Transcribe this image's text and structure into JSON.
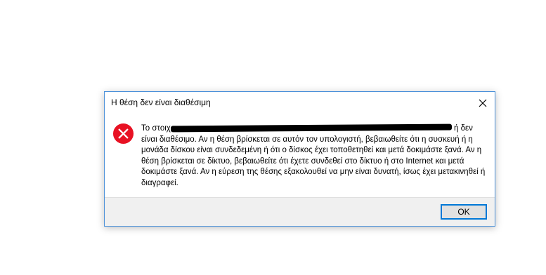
{
  "dialog": {
    "title": "Η θέση δεν είναι διαθέσιμη",
    "message_start": "Το στοιχ",
    "message_after_redaction": "ή δεν είναι",
    "message_rest": "διαθέσιμο. Αν η θέση βρίσκεται σε αυτόν τον υπολογιστή, βεβαιωθείτε ότι η συσκευή ή η μονάδα δίσκου είναι συνδεδεμένη ή ότι ο δίσκος έχει τοποθετηθεί και μετά δοκιμάστε ξανά. Αν η θέση βρίσκεται σε δίκτυο, βεβαιωθείτε ότι έχετε συνδεθεί στο δίκτυο ή στο Internet και μετά δοκιμάστε ξανά. Αν η εύρεση της θέσης εξακολουθεί να μην είναι δυνατή, ίσως έχει μετακινηθεί ή διαγραφεί.",
    "ok_label": "OK",
    "icon": "error-icon",
    "close_icon": "close-icon"
  },
  "colors": {
    "accent": "#0078d7",
    "error": "#e81123",
    "footer_bg": "#f0f0f0"
  }
}
